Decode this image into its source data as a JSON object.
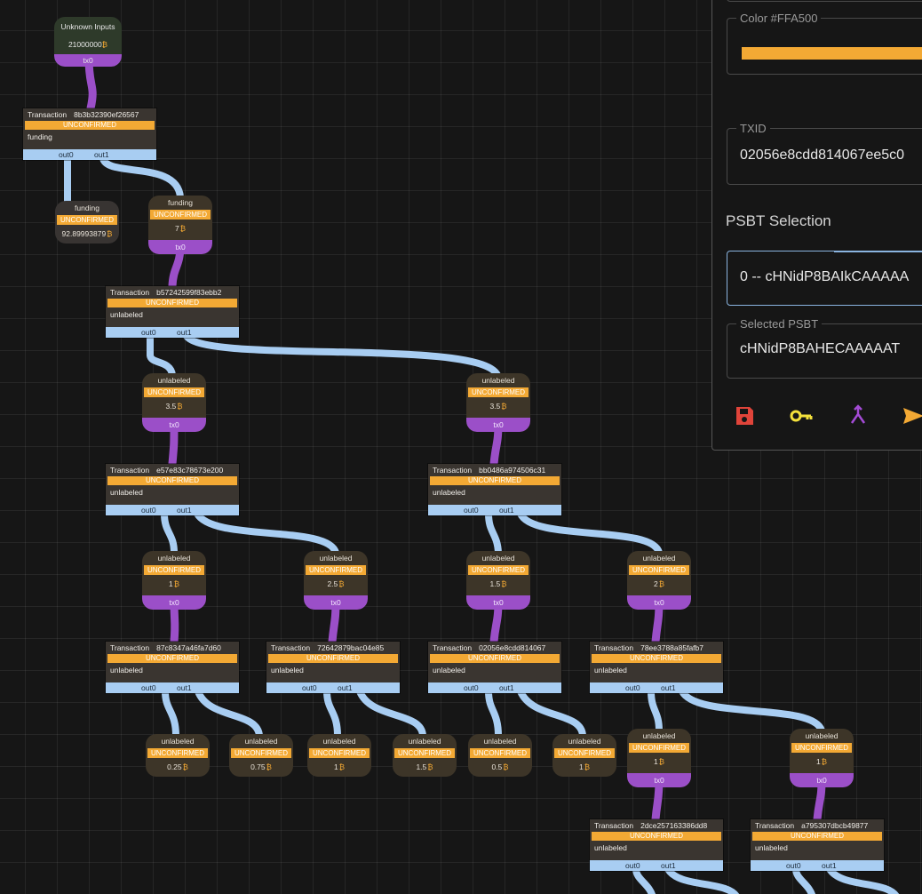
{
  "colors": {
    "accent": "#FFA500",
    "utxo_port": "#9b4fc8",
    "tx_outputs": "#a8cdf2",
    "status": "#f3a934"
  },
  "btc_symbol": "₿",
  "unknown_inputs": {
    "label": "Unknown Inputs",
    "amount": "21000000",
    "port": "tx0"
  },
  "transactions": [
    {
      "id": "tx-8b3b",
      "prefix": "Transaction",
      "txid": "8b3b32390ef26567",
      "status": "UNCONFIRMED",
      "label": "funding",
      "out0": "out0",
      "out1": "out1"
    },
    {
      "id": "tx-b572",
      "prefix": "Transaction",
      "txid": "b57242599f83ebb2",
      "status": "UNCONFIRMED",
      "label": "unlabeled",
      "out0": "out0",
      "out1": "out1"
    },
    {
      "id": "tx-e57e",
      "prefix": "Transaction",
      "txid": "e57e83c78673e200",
      "status": "UNCONFIRMED",
      "label": "unlabeled",
      "out0": "out0",
      "out1": "out1"
    },
    {
      "id": "tx-bb04",
      "prefix": "Transaction",
      "txid": "bb0486a974506c31",
      "status": "UNCONFIRMED",
      "label": "unlabeled",
      "out0": "out0",
      "out1": "out1"
    },
    {
      "id": "tx-87c8",
      "prefix": "Transaction",
      "txid": "87c8347a46fa7d60",
      "status": "UNCONFIRMED",
      "label": "unlabeled",
      "out0": "out0",
      "out1": "out1"
    },
    {
      "id": "tx-7264",
      "prefix": "Transaction",
      "txid": "72642879bac04e85",
      "status": "UNCONFIRMED",
      "label": "unlabeled",
      "out0": "out0",
      "out1": "out1"
    },
    {
      "id": "tx-0205",
      "prefix": "Transaction",
      "txid": "02056e8cdd814067",
      "status": "UNCONFIRMED",
      "label": "unlabeled",
      "out0": "out0",
      "out1": "out1"
    },
    {
      "id": "tx-78ee",
      "prefix": "Transaction",
      "txid": "78ee3788a85fafb7",
      "status": "UNCONFIRMED",
      "label": "unlabeled",
      "out0": "out0",
      "out1": "out1"
    },
    {
      "id": "tx-2dce",
      "prefix": "Transaction",
      "txid": "2dce257163386dd8",
      "status": "UNCONFIRMED",
      "label": "unlabeled",
      "out0": "out0",
      "out1": "out1"
    },
    {
      "id": "tx-a795",
      "prefix": "Transaction",
      "txid": "a795307dbcb49877",
      "status": "UNCONFIRMED",
      "label": "unlabeled",
      "out0": "out0",
      "out1": "out1"
    }
  ],
  "utxos": [
    {
      "id": "u-funding-a",
      "label": "funding",
      "status": "UNCONFIRMED",
      "amount": "92.89993879",
      "port": ""
    },
    {
      "id": "u-funding-b",
      "label": "funding",
      "status": "UNCONFIRMED",
      "amount": "7",
      "port": "tx0"
    },
    {
      "id": "u-1",
      "label": "unlabeled",
      "status": "UNCONFIRMED",
      "amount": "3.5",
      "port": "tx0"
    },
    {
      "id": "u-2",
      "label": "unlabeled",
      "status": "UNCONFIRMED",
      "amount": "3.5",
      "port": "tx0"
    },
    {
      "id": "u-3",
      "label": "unlabeled",
      "status": "UNCONFIRMED",
      "amount": "1",
      "port": "tx0"
    },
    {
      "id": "u-4",
      "label": "unlabeled",
      "status": "UNCONFIRMED",
      "amount": "2.5",
      "port": "tx0"
    },
    {
      "id": "u-5",
      "label": "unlabeled",
      "status": "UNCONFIRMED",
      "amount": "1.5",
      "port": "tx0"
    },
    {
      "id": "u-6",
      "label": "unlabeled",
      "status": "UNCONFIRMED",
      "amount": "2",
      "port": "tx0"
    },
    {
      "id": "u-7",
      "label": "unlabeled",
      "status": "UNCONFIRMED",
      "amount": "0.25",
      "port": ""
    },
    {
      "id": "u-8",
      "label": "unlabeled",
      "status": "UNCONFIRMED",
      "amount": "0.75",
      "port": ""
    },
    {
      "id": "u-9",
      "label": "unlabeled",
      "status": "UNCONFIRMED",
      "amount": "1",
      "port": ""
    },
    {
      "id": "u-10",
      "label": "unlabeled",
      "status": "UNCONFIRMED",
      "amount": "1.5",
      "port": ""
    },
    {
      "id": "u-11",
      "label": "unlabeled",
      "status": "UNCONFIRMED",
      "amount": "0.5",
      "port": ""
    },
    {
      "id": "u-12",
      "label": "unlabeled",
      "status": "UNCONFIRMED",
      "amount": "1",
      "port": ""
    },
    {
      "id": "u-13",
      "label": "unlabeled",
      "status": "UNCONFIRMED",
      "amount": "1",
      "port": "tx0"
    },
    {
      "id": "u-14",
      "label": "unlabeled",
      "status": "UNCONFIRMED",
      "amount": "1",
      "port": "tx0"
    }
  ],
  "panel": {
    "color_legend": "Color #FFA500",
    "txid_legend": "TXID",
    "txid_value": "02056e8cdd814067ee5c0",
    "psbt_section_title": "PSBT Selection",
    "psbt_select_value": "0 -- cHNidP8BAIkCAAAAA",
    "selected_psbt_legend": "Selected PSBT",
    "selected_psbt_value": "cHNidP8BAHECAAAAAT",
    "actions": [
      "save-icon",
      "key-icon",
      "merge-icon",
      "send-icon"
    ]
  }
}
